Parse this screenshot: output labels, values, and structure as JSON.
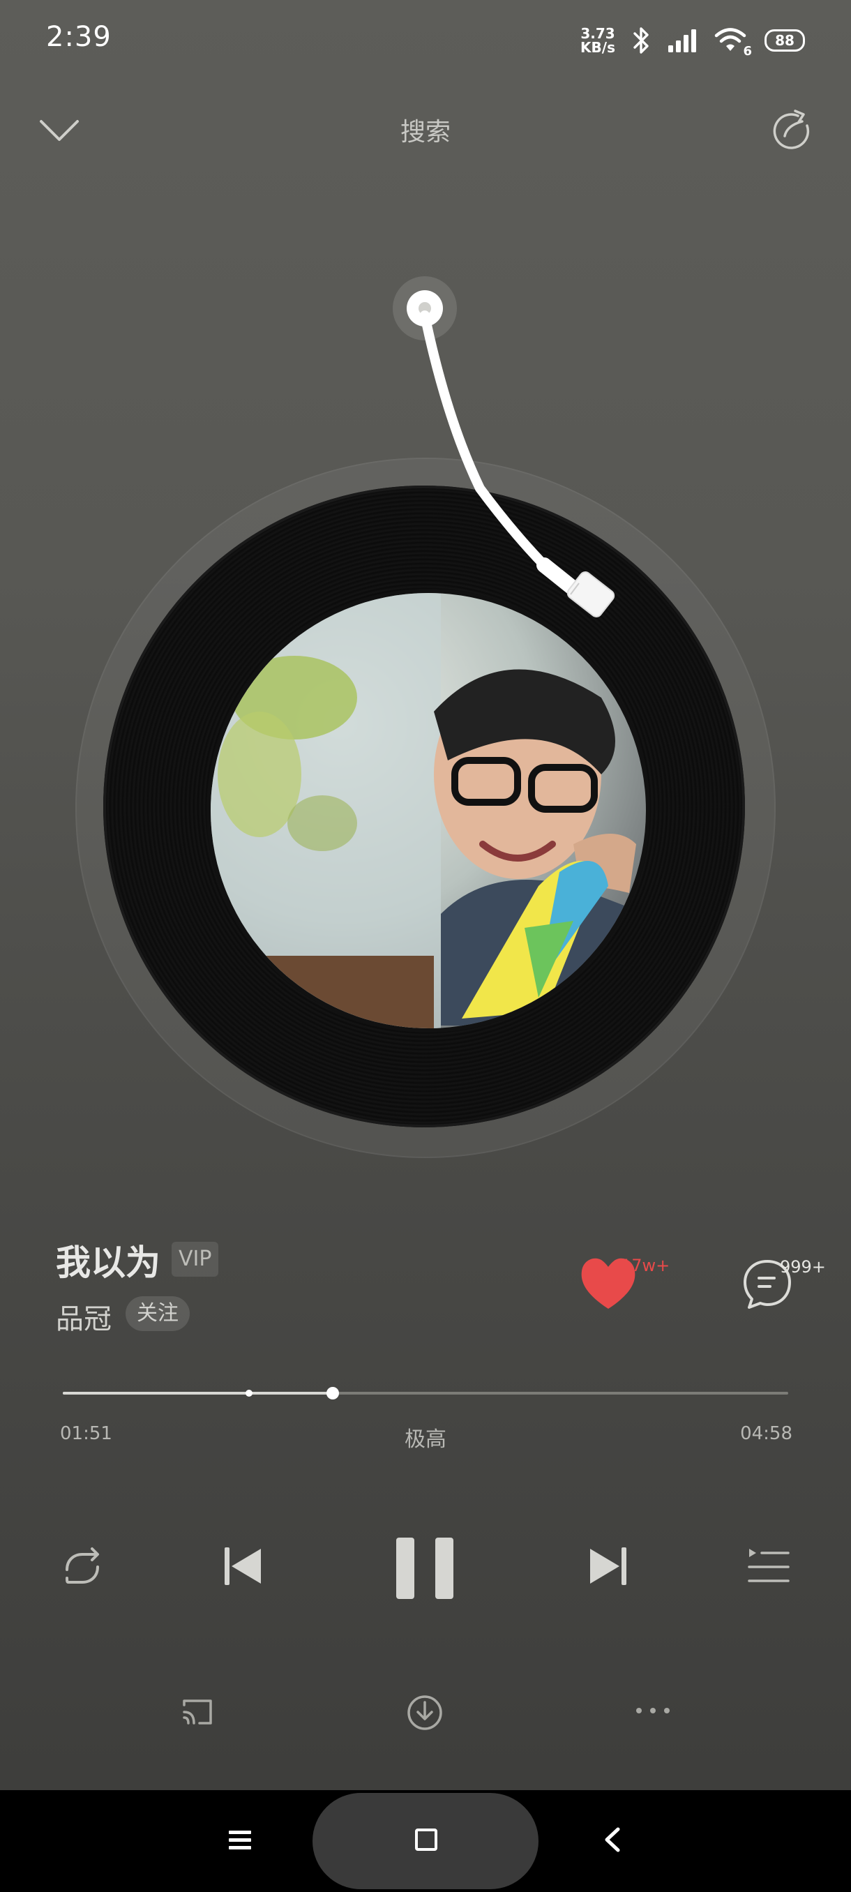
{
  "status_bar": {
    "time": "2:39",
    "net_speed_value": "3.73",
    "net_speed_unit": "KB/s",
    "wifi_sub": "6",
    "battery": "88"
  },
  "top_bar": {
    "title": "搜索"
  },
  "song": {
    "title": "我以为",
    "vip_badge": "VIP",
    "artist": "品冠",
    "follow_label": "关注",
    "like_count": "17w+",
    "comment_count": "999+"
  },
  "playback": {
    "current_time": "01:51",
    "total_time": "04:58",
    "quality": "极高",
    "progress_fraction": 0.372,
    "buffered_fraction": 0.257,
    "state": "playing"
  },
  "colors": {
    "accent_like": "#e84a4a",
    "background": "#555551"
  },
  "icons": {
    "back": "chevron-down-icon",
    "share": "share-icon",
    "repeat": "repeat-icon",
    "prev": "skip-previous-icon",
    "pause": "pause-icon",
    "next": "skip-next-icon",
    "playlist": "playlist-icon",
    "cast": "cast-icon",
    "download": "download-icon",
    "more": "more-icon",
    "like": "heart-icon",
    "comment": "comment-icon",
    "nav_menu": "menu-icon",
    "nav_home": "home-square-icon",
    "nav_back": "back-arrow-icon"
  }
}
